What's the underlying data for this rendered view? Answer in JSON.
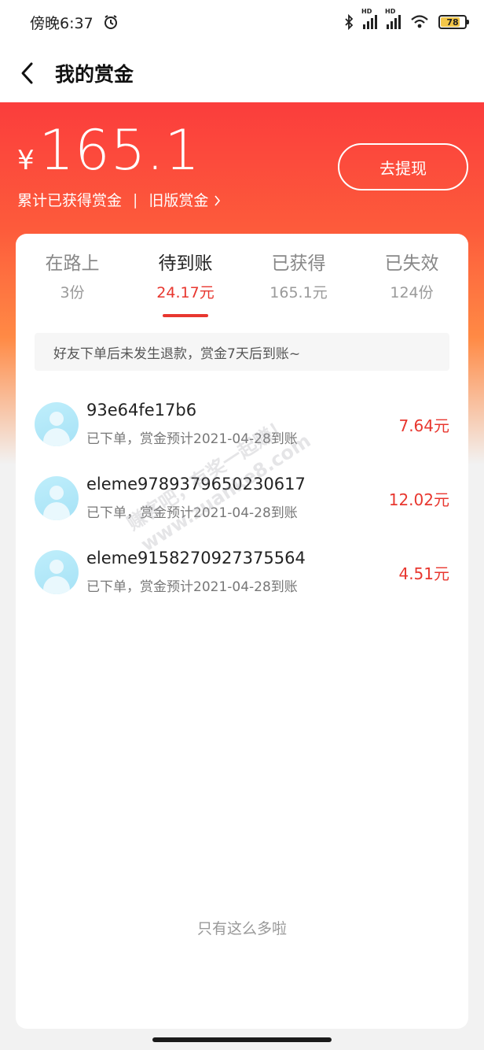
{
  "status_bar": {
    "time": "傍晚6:37",
    "battery": "78"
  },
  "nav": {
    "title": "我的赏金"
  },
  "hero": {
    "currency": "¥",
    "amount": "165.1",
    "cumulative_label": "累计已获得赏金",
    "separator": "|",
    "old_version_label": "旧版赏金",
    "withdraw_label": "去提现"
  },
  "tabs": [
    {
      "label": "在路上",
      "sub": "3份"
    },
    {
      "label": "待到账",
      "sub": "24.17元",
      "active": true
    },
    {
      "label": "已获得",
      "sub": "165.1元"
    },
    {
      "label": "已失效",
      "sub": "124份"
    }
  ],
  "notice": "好友下单后未发生退款，赏金7天后到账~",
  "items": [
    {
      "name": "93e64fe17b6",
      "status": "已下单，赏金预计2021-04-28到账",
      "amount": "7.64元"
    },
    {
      "name": "eleme9789379650230617",
      "status": "已下单，赏金预计2021-04-28到账",
      "amount": "12.02元"
    },
    {
      "name": "eleme9158270927375564",
      "status": "已下单，赏金预计2021-04-28到账",
      "amount": "4.51元"
    }
  ],
  "end_text": "只有这么多啦",
  "watermark": {
    "line1": "赚客吧，有奖一起赚！",
    "line2": "www.zuanke8.com"
  },
  "colors": {
    "accent": "#e8372f",
    "hero_top": "#fb3d3c",
    "hero_bottom": "#ff8a45"
  }
}
